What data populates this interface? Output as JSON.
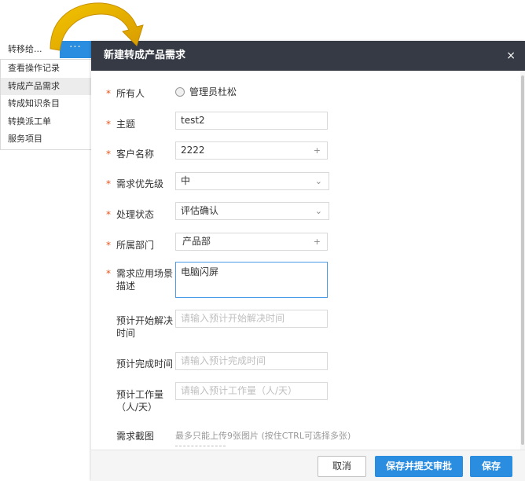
{
  "menu": {
    "transfer_label": "转移给...",
    "more_label": "···",
    "items": [
      {
        "label": "查看操作记录"
      },
      {
        "label": "转成产品需求"
      },
      {
        "label": "转成知识条目"
      },
      {
        "label": "转换派工单"
      },
      {
        "label": "服务项目"
      }
    ]
  },
  "dialog": {
    "title": "新建转成产品需求",
    "close_label": "×",
    "fields": {
      "owner": {
        "label": "所有人",
        "value": "管理员杜松"
      },
      "subject": {
        "label": "主题",
        "value": "test2"
      },
      "customer": {
        "label": "客户名称",
        "value": "2222",
        "suffix": "+"
      },
      "priority": {
        "label": "需求优先级",
        "value": "中",
        "suffix": "⌄"
      },
      "status": {
        "label": "处理状态",
        "value": "评估确认",
        "suffix": "⌄"
      },
      "department": {
        "label": "所属部门",
        "value": "产品部",
        "suffix": "+"
      },
      "scenario": {
        "label_line1": "需求应用场景",
        "label_line2": "描述",
        "value": "电脑闪屏"
      },
      "start_time": {
        "label_line1": "预计开始解决",
        "label_line2": "时间",
        "placeholder": "请输入预计开始解决时间"
      },
      "finish_time": {
        "label": "预计完成时间",
        "placeholder": "请输入预计完成时间"
      },
      "workload": {
        "label_line1": "预计工作量",
        "label_line2": "（人/天）",
        "placeholder": "请输入预计工作量（人/天）"
      },
      "screenshot": {
        "label": "需求截图",
        "hint": "最多只能上传9张图片 (按住CTRL可选择多张)"
      }
    },
    "required_mark": "*",
    "buttons": {
      "cancel": "取消",
      "save_submit": "保存并提交审批",
      "save": "保存"
    }
  },
  "colors": {
    "header_bg": "#353a45",
    "primary": "#2b8de0",
    "required": "#e8541e",
    "arrow": "#e8b800"
  }
}
